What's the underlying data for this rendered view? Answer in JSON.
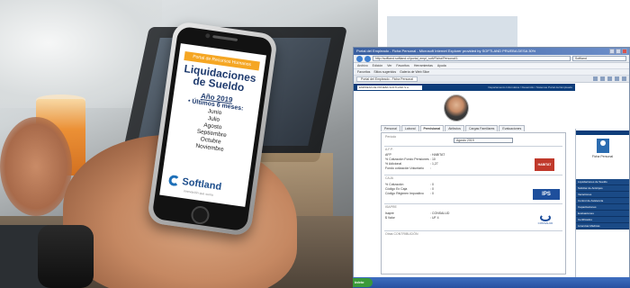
{
  "phone": {
    "badge": "Portal de Recursos Humanos",
    "title": "Liquidaciones de Sueldo",
    "year": "Año 2019",
    "last": "• Últimos 6 meses:",
    "months": [
      "Junio",
      "Julio",
      "Agosto",
      "Septiembre",
      "Octubre",
      "Noviembre"
    ],
    "brand": "Softland",
    "brand_sub": "innovación que suma"
  },
  "browser": {
    "title": "Portal del Empleado - Ficha Personal - Microsoft Internet Explorer provided by SOFTLAND PRUEBA DESA 30%",
    "address": "http://softland.softland.cl/portal_empl_soft/Ficha/Personal/1",
    "search_placeholder": "Softland",
    "menu": [
      "Archivo",
      "Edición",
      "Ver",
      "Favoritos",
      "Herramientas",
      "Ayuda"
    ],
    "favorites": [
      "Favoritos",
      "Sitios sugeridos",
      "Galería de Web Slice"
    ],
    "tab": "Portal del Empleado - Ficha Personal",
    "status": "http://localhost/portalempleado/portal_empl_soft/Ficha/Personal"
  },
  "app": {
    "header_select": "EMPRESA DE PRUEBA SOFTLAND S.A.",
    "header_right": "Departamento Informática / Desarrollo / Sistemas Portal del Empleado",
    "tabs": [
      "Personal",
      "Laboral",
      "Previsional",
      "Atributos",
      "Cargas Familiares",
      "Evaluaciones"
    ],
    "active_tab": "Previsional",
    "periodo_label": "Período",
    "periodo_value": "Agosto 2019",
    "sections": {
      "afp": "A.F.P.",
      "isapre": "ISAPRE",
      "caja": "CAJA",
      "otras": "Otras CONTRIBUCIÓN"
    },
    "afp_rows": [
      {
        "k": "AFP",
        "v": ": HABITAT"
      },
      {
        "k": "% Cotización Fondo Pensiones",
        "v": ": 10"
      },
      {
        "k": "% Adicional",
        "v": ": 1,27"
      },
      {
        "k": "Fondo cotización Voluntario",
        "v": ":"
      }
    ],
    "ips_rows": [
      {
        "k": "% Cotización",
        "v": ": 0"
      },
      {
        "k": "Código Ex Caja",
        "v": ": 0"
      },
      {
        "k": "Código Régimen Impositivo",
        "v": ": 0"
      }
    ],
    "isapre_rows": [
      {
        "k": "Isapre",
        "v": ": CONSALUD"
      },
      {
        "k": "$ Valor",
        "v": ": UF 4"
      }
    ],
    "logo_habitat": "HABITAT",
    "logo_ips": "IPS",
    "logo_consalud": "CONSALUD"
  },
  "sidebar": {
    "panel_label": "Ficha Personal",
    "menu": [
      "Liquidaciones de Sueldo",
      "Solicitar de Anticipos",
      "Vacaciones",
      "Control de Asistencia",
      "Capacitaciones",
      "Evaluaciones",
      "Certificados",
      "Licencias Médicas"
    ]
  },
  "taskbar": {
    "start": "Inicio"
  }
}
